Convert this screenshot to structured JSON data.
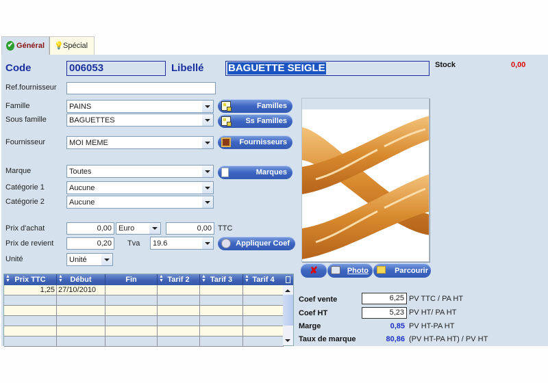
{
  "tabs": [
    {
      "label": "Général",
      "icon": "check-circle-icon",
      "active": true
    },
    {
      "label": "Spécial",
      "icon": "lightbulb-icon",
      "active": false
    }
  ],
  "header": {
    "code_label": "Code",
    "code_value": "006053",
    "libelle_label": "Libellé",
    "libelle_value": "BAGUETTE SEIGLE",
    "stock_label": "Stock",
    "stock_value": "0,00"
  },
  "form": {
    "ref_fournisseur": {
      "label": "Ref.fournisseur",
      "value": ""
    },
    "famille": {
      "label": "Famille",
      "value": "PAINS"
    },
    "sous_famille": {
      "label": "Sous famille",
      "value": "BAGUETTES"
    },
    "fournisseur": {
      "label": "Fournisseur",
      "value": "MOI MEME"
    },
    "marque": {
      "label": "Marque",
      "value": "Toutes"
    },
    "categorie1": {
      "label": "Catégorie 1",
      "value": "Aucune"
    },
    "categorie2": {
      "label": "Catégorie 2",
      "value": "Aucune"
    },
    "prix_achat": {
      "label": "Prix d'achat",
      "value": "0,00",
      "currency": "Euro",
      "ttc_value": "0,00",
      "ttc_label": "TTC"
    },
    "prix_revient": {
      "label": "Prix de revient",
      "value": "0,20"
    },
    "tva": {
      "label": "Tva",
      "value": "19.6"
    },
    "unite": {
      "label": "Unité",
      "value": "Unité"
    }
  },
  "buttons": {
    "familles": "Familles",
    "ss_familles": "Ss Familles",
    "fournisseurs": "Fournisseurs",
    "marques": "Marques",
    "appliquer_coef": "Appliquer Coef",
    "photo": "Photo",
    "parcourir": "Parcourir"
  },
  "tarifs_table": {
    "columns": [
      "Prix TTC",
      "Début",
      "Fin",
      "Tarif 2",
      "Tarif 3",
      "Tarif 4"
    ],
    "rows": [
      [
        "1,25",
        "27/10/2010",
        "",
        "",
        "",
        ""
      ],
      [
        "",
        "",
        "",
        "",
        "",
        ""
      ],
      [
        "",
        "",
        "",
        "",
        "",
        ""
      ],
      [
        "",
        "",
        "",
        "",
        "",
        ""
      ],
      [
        "",
        "",
        "",
        "",
        "",
        ""
      ],
      [
        "",
        "",
        "",
        "",
        "",
        ""
      ]
    ]
  },
  "coefs": {
    "coef_vente": {
      "label": "Coef vente",
      "value": "6,25",
      "formula": "PV TTC / PA HT"
    },
    "coef_ht": {
      "label": "Coef HT",
      "value": "5,23",
      "formula": "PV HT/ PA HT"
    },
    "marge": {
      "label": "Marge",
      "value": "0,85",
      "formula": "PV HT-PA HT"
    },
    "taux_marque": {
      "label": "Taux de marque",
      "value": "80,86",
      "formula": "(PV HT-PA HT) / PV HT"
    }
  },
  "photo": {
    "alt": "Baguettes"
  },
  "colors": {
    "panel_bg": "#d5e2ee",
    "accent_blue": "#1a2fa0",
    "stock_red": "#e00000",
    "value_blue": "#1a2fc8"
  }
}
